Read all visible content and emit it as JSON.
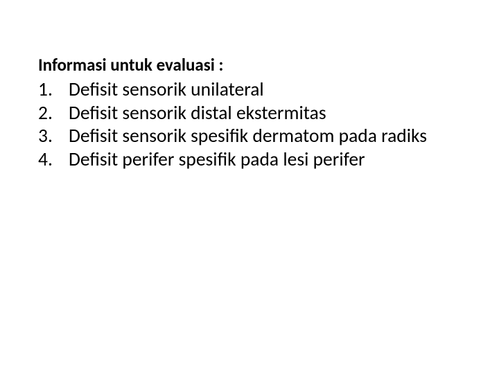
{
  "heading": "Informasi untuk evaluasi  :",
  "items": [
    {
      "num": "1.",
      "text": "Defisit sensorik unilateral"
    },
    {
      "num": "2.",
      "text": "Defisit sensorik distal ekstermitas"
    },
    {
      "num": "3.",
      "text": "Defisit sensorik spesifik dermatom pada radiks"
    },
    {
      "num": "4.",
      "text": "Defisit perifer spesifik pada lesi perifer"
    }
  ]
}
